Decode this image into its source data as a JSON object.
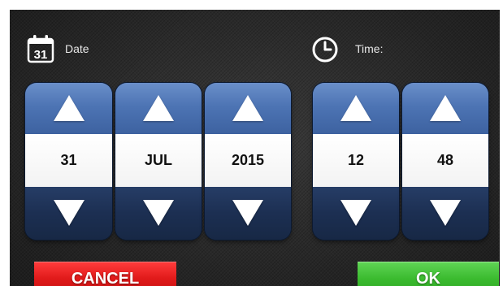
{
  "date": {
    "label": "Date",
    "icon": "calendar-icon",
    "icon_text": "31",
    "day": "31",
    "month": "JUL",
    "year": "2015"
  },
  "time": {
    "label": "Time:",
    "icon": "clock-icon",
    "hour": "12",
    "minute": "48"
  },
  "buttons": {
    "cancel_label": "CANCEL",
    "ok_label": "OK"
  },
  "colors": {
    "spinner_blue": "#4d74b4",
    "spinner_dark": "#1c2f52",
    "cancel_red": "#e01a1a",
    "ok_green": "#3bbb2f",
    "background": "#272727"
  }
}
